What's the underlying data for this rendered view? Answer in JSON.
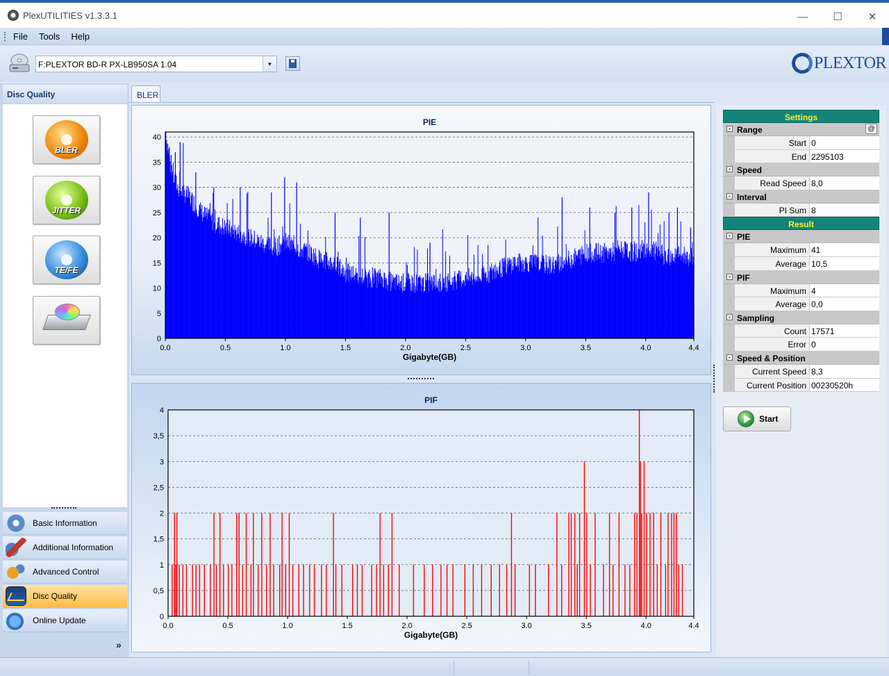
{
  "window": {
    "title": "PlexUTILITIES v1.3.3.1",
    "minimize_glyph": "—",
    "maximize_glyph": "☐",
    "close_glyph": "✕"
  },
  "menu": [
    "File",
    "Tools",
    "Help"
  ],
  "toolbar": {
    "drive_value": "F:PLEXTOR BD-R  PX-LB950SA  1.04",
    "dropdown_glyph": "▼",
    "logo_text": "PLEXTOR"
  },
  "left_pane": {
    "header": "Disc Quality",
    "buttons": [
      {
        "label": "BLER",
        "icon": "bler-disc-icon"
      },
      {
        "label": "JITTER",
        "icon": "jitter-disc-icon"
      },
      {
        "label": "TE/FE",
        "icon": "tefe-disc-icon"
      },
      {
        "label": "",
        "icon": "drive-disc-icon"
      }
    ],
    "nav": [
      {
        "label": "Basic Information",
        "icon": "basic-info-icon"
      },
      {
        "label": "Additional Information",
        "icon": "additional-info-icon"
      },
      {
        "label": "Advanced Control",
        "icon": "advanced-control-icon"
      },
      {
        "label": "Disc Quality",
        "icon": "disc-quality-icon",
        "active": true
      },
      {
        "label": "Online Update",
        "icon": "online-update-icon"
      }
    ],
    "more_glyph": "»"
  },
  "tab": {
    "label": "BLER"
  },
  "chart_data": [
    {
      "type": "bar",
      "title": "PIE",
      "xlabel": "Gigabyte(GB)",
      "ylabel": "",
      "xlim": [
        0.0,
        4.4
      ],
      "ylim": [
        0,
        41
      ],
      "x_ticks": [
        "0.0",
        "0.5",
        "1.0",
        "1.5",
        "2.0",
        "2.5",
        "3.0",
        "3.5",
        "4.0",
        "4.4"
      ],
      "y_ticks": [
        "0",
        "5",
        "10",
        "15",
        "20",
        "25",
        "30",
        "35",
        "40"
      ],
      "color": "#0000ff",
      "grid": "horizontal-dashed",
      "maximum": 41,
      "average": 10.5,
      "profile": [
        [
          0.0,
          41
        ],
        [
          0.05,
          33
        ],
        [
          0.1,
          30
        ],
        [
          0.2,
          28
        ],
        [
          0.3,
          25
        ],
        [
          0.4,
          23
        ],
        [
          0.5,
          22
        ],
        [
          0.6,
          21
        ],
        [
          0.7,
          20
        ],
        [
          0.8,
          19
        ],
        [
          0.9,
          18
        ],
        [
          1.0,
          19
        ],
        [
          1.1,
          18
        ],
        [
          1.2,
          17
        ],
        [
          1.3,
          15.5
        ],
        [
          1.4,
          15
        ],
        [
          1.5,
          13
        ],
        [
          1.6,
          12.5
        ],
        [
          1.7,
          12
        ],
        [
          1.8,
          12
        ],
        [
          1.9,
          11
        ],
        [
          2.0,
          11
        ],
        [
          2.1,
          11
        ],
        [
          2.2,
          11
        ],
        [
          2.3,
          11
        ],
        [
          2.4,
          11.5
        ],
        [
          2.5,
          12
        ],
        [
          2.6,
          12
        ],
        [
          2.7,
          13
        ],
        [
          2.8,
          14
        ],
        [
          2.9,
          15
        ],
        [
          3.0,
          15
        ],
        [
          3.1,
          15
        ],
        [
          3.2,
          14.5
        ],
        [
          3.3,
          15
        ],
        [
          3.4,
          16
        ],
        [
          3.5,
          17
        ],
        [
          3.6,
          17
        ],
        [
          3.7,
          17
        ],
        [
          3.8,
          17.5
        ],
        [
          3.9,
          17
        ],
        [
          4.0,
          18
        ],
        [
          4.1,
          17
        ],
        [
          4.2,
          16
        ],
        [
          4.3,
          16.5
        ],
        [
          4.4,
          16
        ]
      ],
      "spikes": [
        [
          0.0,
          41
        ],
        [
          0.03,
          38
        ],
        [
          0.08,
          37
        ],
        [
          0.12,
          39
        ],
        [
          0.25,
          33
        ],
        [
          0.4,
          30
        ],
        [
          0.62,
          30
        ],
        [
          0.88,
          29
        ],
        [
          0.99,
          32
        ],
        [
          1.09,
          31
        ],
        [
          1.41,
          25
        ],
        [
          1.62,
          24
        ],
        [
          1.86,
          25
        ],
        [
          2.2,
          19
        ],
        [
          3.3,
          28
        ],
        [
          3.53,
          26
        ],
        [
          3.74,
          25
        ],
        [
          3.88,
          26
        ],
        [
          4.02,
          29
        ],
        [
          4.19,
          25
        ],
        [
          4.26,
          26
        ],
        [
          4.37,
          22
        ]
      ]
    },
    {
      "type": "bar",
      "title": "PIF",
      "xlabel": "Gigabyte(GB)",
      "ylabel": "",
      "xlim": [
        0.0,
        4.4
      ],
      "ylim": [
        0,
        4
      ],
      "x_ticks": [
        "0.0",
        "0.5",
        "1.0",
        "1.5",
        "2.0",
        "2.5",
        "3.0",
        "3.5",
        "4.0",
        "4.4"
      ],
      "y_ticks": [
        "0",
        "0,5",
        "1",
        "1,5",
        "2",
        "2,5",
        "3",
        "3,5",
        "4"
      ],
      "color": "#ff0000",
      "grid": "horizontal-dashed",
      "maximum": 4,
      "average": 0.0,
      "events": [
        [
          0.03,
          1
        ],
        [
          0.05,
          2
        ],
        [
          0.06,
          1
        ],
        [
          0.07,
          2
        ],
        [
          0.09,
          1
        ],
        [
          0.12,
          1
        ],
        [
          0.15,
          1
        ],
        [
          0.2,
          1
        ],
        [
          0.23,
          1
        ],
        [
          0.26,
          1
        ],
        [
          0.3,
          1
        ],
        [
          0.35,
          1
        ],
        [
          0.38,
          2
        ],
        [
          0.4,
          1
        ],
        [
          0.43,
          2
        ],
        [
          0.46,
          1
        ],
        [
          0.5,
          1
        ],
        [
          0.53,
          1
        ],
        [
          0.57,
          2
        ],
        [
          0.59,
          2
        ],
        [
          0.62,
          1
        ],
        [
          0.65,
          2
        ],
        [
          0.69,
          1
        ],
        [
          0.71,
          2
        ],
        [
          0.75,
          1
        ],
        [
          0.78,
          2
        ],
        [
          0.82,
          1
        ],
        [
          0.85,
          2
        ],
        [
          0.88,
          1
        ],
        [
          0.93,
          1
        ],
        [
          0.95,
          2
        ],
        [
          0.98,
          1
        ],
        [
          1.01,
          2
        ],
        [
          1.04,
          1
        ],
        [
          1.09,
          1
        ],
        [
          1.13,
          1
        ],
        [
          1.18,
          1
        ],
        [
          1.22,
          1
        ],
        [
          1.28,
          1
        ],
        [
          1.32,
          1
        ],
        [
          1.38,
          2
        ],
        [
          1.4,
          1
        ],
        [
          1.45,
          1
        ],
        [
          1.54,
          1
        ],
        [
          1.58,
          1
        ],
        [
          1.62,
          1
        ],
        [
          1.7,
          1
        ],
        [
          1.74,
          1
        ],
        [
          1.77,
          2
        ],
        [
          1.8,
          1
        ],
        [
          1.84,
          1
        ],
        [
          1.87,
          2
        ],
        [
          1.93,
          1
        ],
        [
          2.05,
          1
        ],
        [
          2.14,
          1
        ],
        [
          2.21,
          1
        ],
        [
          2.28,
          1
        ],
        [
          2.33,
          1
        ],
        [
          2.38,
          1
        ],
        [
          2.48,
          1
        ],
        [
          2.55,
          1
        ],
        [
          2.62,
          1
        ],
        [
          2.7,
          1
        ],
        [
          2.77,
          1
        ],
        [
          2.83,
          1
        ],
        [
          2.87,
          2
        ],
        [
          2.9,
          1
        ],
        [
          3.02,
          1
        ],
        [
          3.07,
          1
        ],
        [
          3.18,
          1
        ],
        [
          3.25,
          2
        ],
        [
          3.29,
          1
        ],
        [
          3.35,
          2
        ],
        [
          3.37,
          2
        ],
        [
          3.4,
          2
        ],
        [
          3.42,
          1
        ],
        [
          3.44,
          2
        ],
        [
          3.48,
          3
        ],
        [
          3.5,
          2
        ],
        [
          3.53,
          1
        ],
        [
          3.57,
          2
        ],
        [
          3.64,
          1
        ],
        [
          3.69,
          2
        ],
        [
          3.72,
          1
        ],
        [
          3.77,
          2
        ],
        [
          3.82,
          1
        ],
        [
          3.86,
          1
        ],
        [
          3.9,
          2
        ],
        [
          3.92,
          2
        ],
        [
          3.94,
          4
        ],
        [
          3.95,
          3
        ],
        [
          3.96,
          2
        ],
        [
          3.98,
          3
        ],
        [
          4.0,
          2
        ],
        [
          4.03,
          2
        ],
        [
          4.06,
          2
        ],
        [
          4.09,
          1
        ],
        [
          4.12,
          2
        ],
        [
          4.16,
          1
        ],
        [
          4.18,
          2
        ],
        [
          4.21,
          2
        ],
        [
          4.23,
          2
        ],
        [
          4.25,
          2
        ],
        [
          4.27,
          1
        ],
        [
          4.3,
          1
        ]
      ]
    }
  ],
  "settings": {
    "title": "Settings",
    "at_glyph": "@",
    "groups": [
      {
        "name": "Range",
        "rows": [
          {
            "label": "Start",
            "value": "0"
          },
          {
            "label": "End",
            "value": "2295103"
          }
        ]
      },
      {
        "name": "Speed",
        "rows": [
          {
            "label": "Read Speed",
            "value": "8,0"
          }
        ]
      },
      {
        "name": "Interval",
        "rows": [
          {
            "label": "PI Sum",
            "value": "8"
          }
        ]
      }
    ]
  },
  "result": {
    "title": "Result",
    "groups": [
      {
        "name": "PIE",
        "rows": [
          {
            "label": "Maximum",
            "value": "41"
          },
          {
            "label": "Average",
            "value": "10,5"
          }
        ]
      },
      {
        "name": "PIF",
        "rows": [
          {
            "label": "Maximum",
            "value": "4"
          },
          {
            "label": "Average",
            "value": "0,0"
          }
        ]
      },
      {
        "name": "Sampling",
        "rows": [
          {
            "label": "Count",
            "value": "17571"
          },
          {
            "label": "Error",
            "value": "0"
          }
        ]
      },
      {
        "name": "Speed & Position",
        "rows": [
          {
            "label": "Current Speed",
            "value": "8,3"
          },
          {
            "label": "Current Position",
            "value": "00230520h"
          }
        ]
      }
    ]
  },
  "start_button": {
    "label": "Start"
  }
}
